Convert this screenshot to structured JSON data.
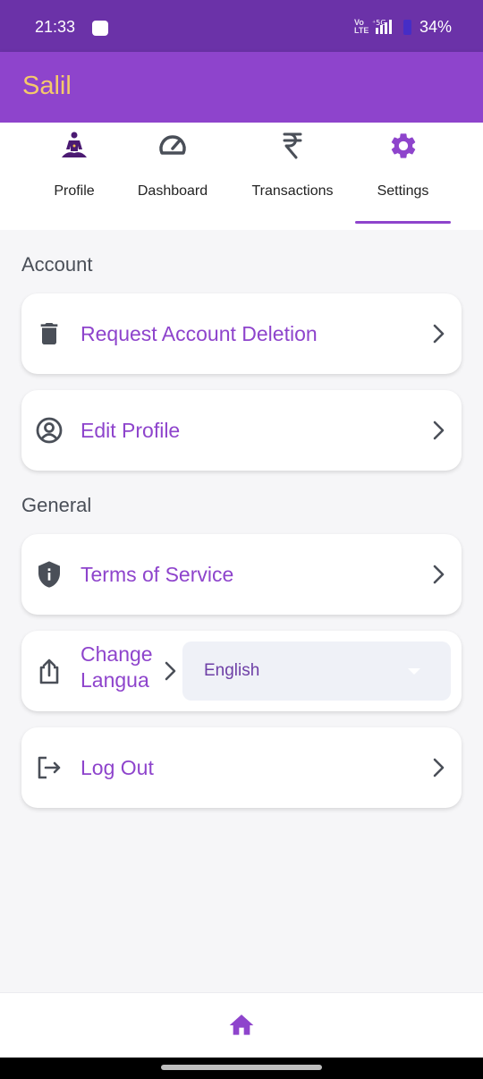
{
  "status_bar": {
    "time": "21:33",
    "network": "Vo\nLTE",
    "signal": "5G",
    "battery": "34%"
  },
  "app_bar": {
    "title": "Salil"
  },
  "tabs": [
    {
      "label": "Profile",
      "icon": "meditation-icon"
    },
    {
      "label": "Dashboard",
      "icon": "speedometer-icon"
    },
    {
      "label": "Transactions",
      "icon": "rupee-icon"
    },
    {
      "label": "Settings",
      "icon": "gear-icon",
      "selected": true
    }
  ],
  "sections": {
    "account": "Account",
    "general": "General"
  },
  "items": {
    "request_deletion": "Request Account Deletion",
    "edit_profile": "Edit Profile",
    "terms": "Terms of Service",
    "change_language_line1": "Change",
    "change_language_line2": "Langua",
    "language_value": "English",
    "log_out": "Log Out"
  },
  "colors": {
    "primary": "#8e44cc",
    "status_bar": "#6b32a8",
    "title": "#f5c96a",
    "icon_gray": "#4a4f58"
  }
}
